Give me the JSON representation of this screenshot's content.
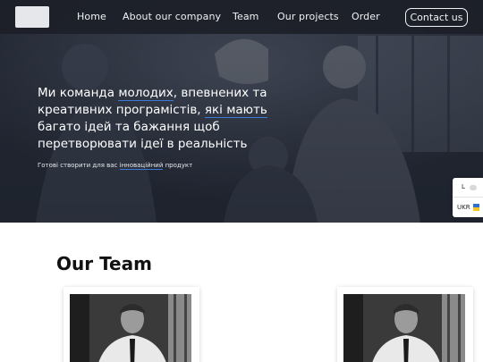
{
  "nav": {
    "links": [
      {
        "label": "Home"
      },
      {
        "label": "About our company"
      },
      {
        "label": "Team"
      },
      {
        "label": "Our projects"
      },
      {
        "label": "Order"
      }
    ],
    "contact_label": "Contact us"
  },
  "hero": {
    "title_parts": [
      "Ми команда ",
      "молодих",
      ", впевнених та креативних програмістів, ",
      "які мають",
      " багато ідей та бажання щоб перетворювати ідеї в реальність"
    ],
    "subtitle_parts": [
      "Готові створити для вас ",
      "інноваційний",
      " продукт"
    ]
  },
  "language": {
    "toggle_label": "L",
    "current": "UKR",
    "flag_colors": {
      "top": "#2f6fd0",
      "bottom": "#f3c623"
    }
  },
  "team": {
    "title": "Our Team"
  },
  "colors": {
    "nav_bg": "#1c1f28",
    "accent_underline": "#3b7ad6"
  }
}
